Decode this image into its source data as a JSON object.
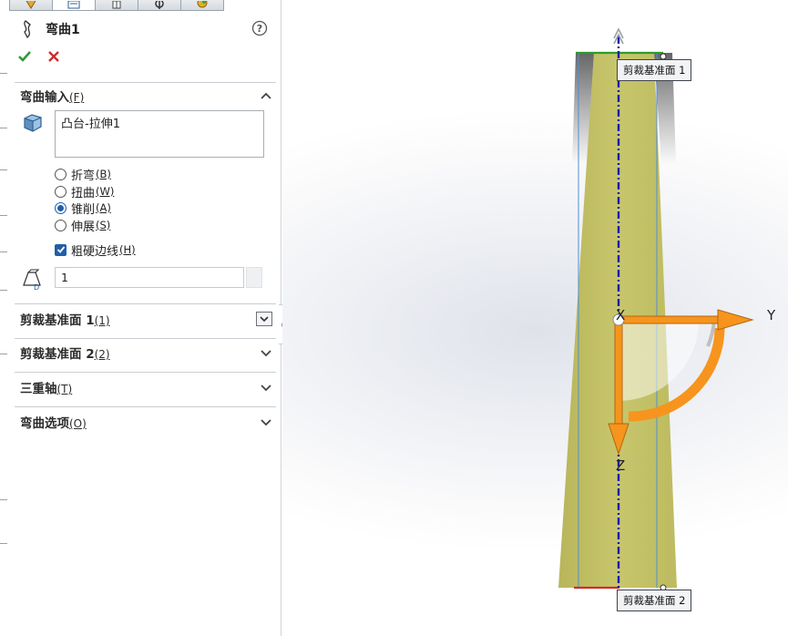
{
  "feature": {
    "title": "弯曲1"
  },
  "sections": {
    "bend_input": {
      "label": "弯曲输入",
      "key": "(F)"
    },
    "trim_plane1": {
      "label": "剪裁基准面 1",
      "key": "(1)"
    },
    "trim_plane2": {
      "label": "剪裁基准面 2",
      "key": "(2)"
    },
    "triad": {
      "label": "三重轴",
      "key": "(T)"
    },
    "options": {
      "label": "弯曲选项",
      "key": "(O)"
    }
  },
  "bodies_to_bend": {
    "value": "凸台-拉伸1"
  },
  "bend_types": [
    {
      "label": "折弯",
      "key": "(B)",
      "selected": false
    },
    {
      "label": "扭曲",
      "key": "(W)",
      "selected": false
    },
    {
      "label": "锥削",
      "key": "(A)",
      "selected": true
    },
    {
      "label": "伸展",
      "key": "(S)",
      "selected": false
    }
  ],
  "rigid_edges": {
    "label": "粗硬边线",
    "key": "(H)",
    "checked": true
  },
  "taper_factor": {
    "value": "1"
  },
  "viewport": {
    "plane1_callout": "剪裁基准面 1",
    "plane2_callout": "剪裁基准面 2",
    "axis_x": "X",
    "axis_y": "Y",
    "axis_z": "Z"
  },
  "colors": {
    "body": "#c2c064",
    "triad_arrow": "#f7941d",
    "centerline": "#1a1aa8",
    "plane1_edge": "#2e9b2e",
    "plane2_edge": "#d42a2a",
    "accent_blue": "#1f5fa8"
  },
  "icons": [
    "bend-feature-icon",
    "help-icon",
    "confirm-icon",
    "cancel-icon",
    "solid-body-icon",
    "taper-factor-icon",
    "chevron-up-icon",
    "chevron-down-icon"
  ]
}
